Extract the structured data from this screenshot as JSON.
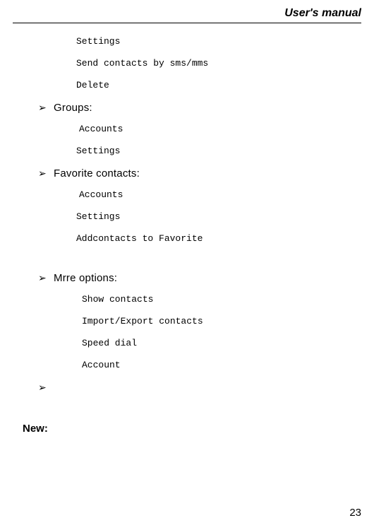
{
  "header": {
    "title": "User's manual"
  },
  "pre_items": [
    "Settings",
    "Send contacts by sms/mms",
    "Delete"
  ],
  "sections": [
    {
      "title": "Groups:",
      "items": [
        "Accounts",
        "Settings"
      ]
    },
    {
      "title": "Favorite contacts:",
      "items": [
        "Accounts",
        "Settings",
        "Addcontacts to Favorite"
      ]
    },
    {
      "title": "Mrre options:",
      "items": [
        "Show contacts",
        "Import/Export contacts",
        "Speed dial",
        "Account"
      ]
    }
  ],
  "chevron_glyph": "➢",
  "new_heading": "New:",
  "page_number": "23"
}
